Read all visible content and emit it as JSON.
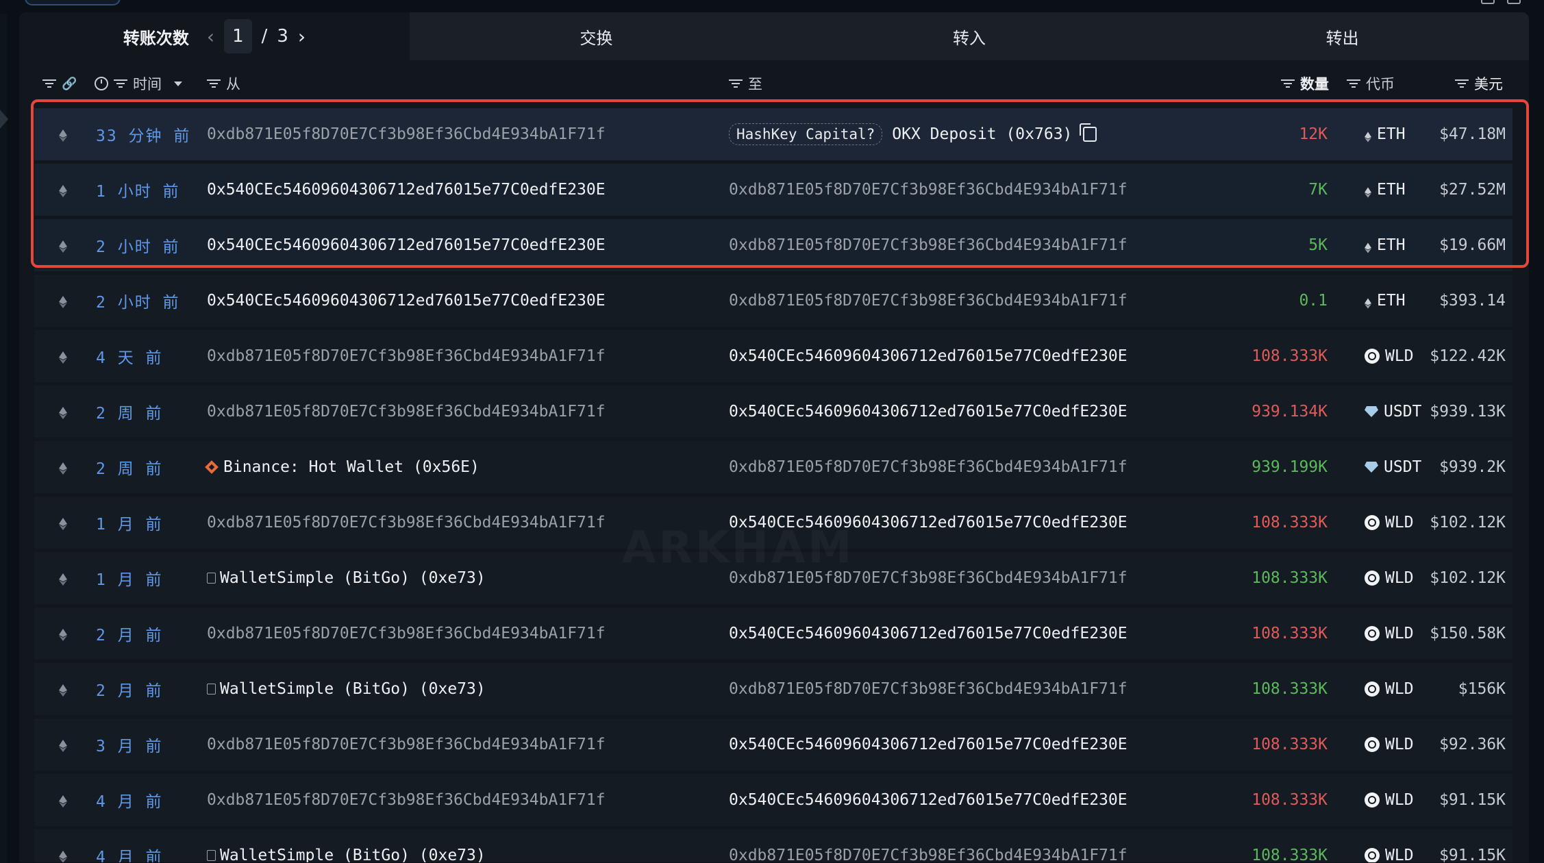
{
  "header": {
    "tab_first_label": "转账次数",
    "pager": {
      "current": "1",
      "separator": "/",
      "total": "3"
    },
    "tabs": [
      {
        "label": "交换"
      },
      {
        "label": "转入"
      },
      {
        "label": "转出"
      }
    ]
  },
  "columns": {
    "time": "时间",
    "from": "从",
    "to": "至",
    "amount": "数量",
    "token": "代币",
    "usd": "美元"
  },
  "watermark": "ARKHAM",
  "rows": [
    {
      "time": "33 分钟 前",
      "from": "0xdb871E05f8D70E7Cf3b98Ef36Cbd4E934bA1F71f",
      "to_tag": "HashKey Capital?",
      "to": "OKX Deposit (0x763)",
      "amount": "12K",
      "amount_color": "red",
      "token": "ETH",
      "usd": "$47.18M"
    },
    {
      "time": "1 小时 前",
      "from": "0x540CEc54609604306712ed76015e77C0edfE230E",
      "to": "0xdb871E05f8D70E7Cf3b98Ef36Cbd4E934bA1F71f",
      "amount": "7K",
      "amount_color": "green",
      "token": "ETH",
      "usd": "$27.52M"
    },
    {
      "time": "2 小时 前",
      "from": "0x540CEc54609604306712ed76015e77C0edfE230E",
      "to": "0xdb871E05f8D70E7Cf3b98Ef36Cbd4E934bA1F71f",
      "amount": "5K",
      "amount_color": "green",
      "token": "ETH",
      "usd": "$19.66M"
    },
    {
      "time": "2 小时 前",
      "from": "0x540CEc54609604306712ed76015e77C0edfE230E",
      "to": "0xdb871E05f8D70E7Cf3b98Ef36Cbd4E934bA1F71f",
      "amount": "0.1",
      "amount_color": "green",
      "token": "ETH",
      "usd": "$393.14"
    },
    {
      "time": "4 天 前",
      "from": "0xdb871E05f8D70E7Cf3b98Ef36Cbd4E934bA1F71f",
      "to": "0x540CEc54609604306712ed76015e77C0edfE230E",
      "amount": "108.333K",
      "amount_color": "red",
      "token": "WLD",
      "usd": "$122.42K"
    },
    {
      "time": "2 周 前",
      "from": "0xdb871E05f8D70E7Cf3b98Ef36Cbd4E934bA1F71f",
      "to": "0x540CEc54609604306712ed76015e77C0edfE230E",
      "amount": "939.134K",
      "amount_color": "red",
      "token": "USDT",
      "usd": "$939.13K"
    },
    {
      "time": "2 周 前",
      "from": "Binance: Hot Wallet (0x56E)",
      "to": "0xdb871E05f8D70E7Cf3b98Ef36Cbd4E934bA1F71f",
      "amount": "939.199K",
      "amount_color": "green",
      "token": "USDT",
      "usd": "$939.2K"
    },
    {
      "time": "1 月 前",
      "from": "0xdb871E05f8D70E7Cf3b98Ef36Cbd4E934bA1F71f",
      "to": "0x540CEc54609604306712ed76015e77C0edfE230E",
      "amount": "108.333K",
      "amount_color": "red",
      "token": "WLD",
      "usd": "$102.12K"
    },
    {
      "time": "1 月 前",
      "from": "WalletSimple (BitGo) (0xe73)",
      "to": "0xdb871E05f8D70E7Cf3b98Ef36Cbd4E934bA1F71f",
      "amount": "108.333K",
      "amount_color": "green",
      "token": "WLD",
      "usd": "$102.12K"
    },
    {
      "time": "2 月 前",
      "from": "0xdb871E05f8D70E7Cf3b98Ef36Cbd4E934bA1F71f",
      "to": "0x540CEc54609604306712ed76015e77C0edfE230E",
      "amount": "108.333K",
      "amount_color": "red",
      "token": "WLD",
      "usd": "$150.58K"
    },
    {
      "time": "2 月 前",
      "from": "WalletSimple (BitGo) (0xe73)",
      "to": "0xdb871E05f8D70E7Cf3b98Ef36Cbd4E934bA1F71f",
      "amount": "108.333K",
      "amount_color": "green",
      "token": "WLD",
      "usd": "$156K"
    },
    {
      "time": "3 月 前",
      "from": "0xdb871E05f8D70E7Cf3b98Ef36Cbd4E934bA1F71f",
      "to": "0x540CEc54609604306712ed76015e77C0edfE230E",
      "amount": "108.333K",
      "amount_color": "red",
      "token": "WLD",
      "usd": "$92.36K"
    },
    {
      "time": "4 月 前",
      "from": "0xdb871E05f8D70E7Cf3b98Ef36Cbd4E934bA1F71f",
      "to": "0x540CEc54609604306712ed76015e77C0edfE230E",
      "amount": "108.333K",
      "amount_color": "red",
      "token": "WLD",
      "usd": "$91.15K"
    },
    {
      "time": "4 月 前",
      "from": "WalletSimple (BitGo) (0xe73)",
      "to": "0xdb871E05f8D70E7Cf3b98Ef36Cbd4E934bA1F71f",
      "amount": "108.333K",
      "amount_color": "green",
      "token": "WLD",
      "usd": "$91.15K"
    }
  ],
  "colors": {
    "red": "#e05a5a",
    "green": "#5cb85c",
    "link": "#5f98e8",
    "highlight": "#e5473b"
  }
}
